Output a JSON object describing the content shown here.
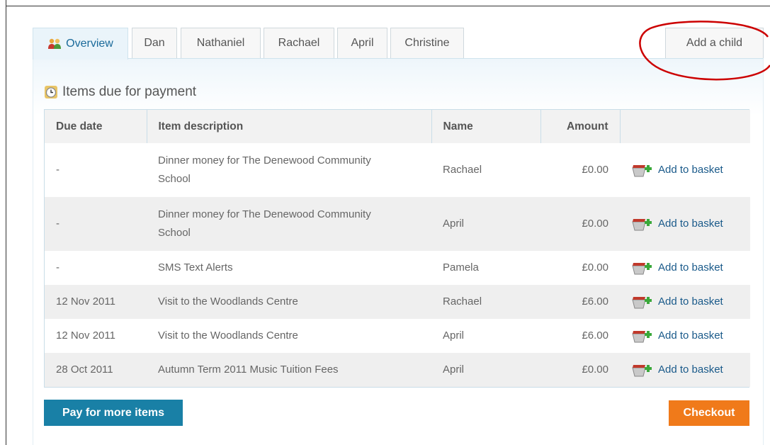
{
  "tabs": [
    {
      "label": "Overview",
      "active": true
    },
    {
      "label": "Dan"
    },
    {
      "label": "Nathaniel"
    },
    {
      "label": "Rachael"
    },
    {
      "label": "April"
    },
    {
      "label": "Christine"
    }
  ],
  "add_child_label": "Add a child",
  "section_title": "Items due for payment",
  "table": {
    "headers": {
      "due_date": "Due date",
      "description": "Item description",
      "name": "Name",
      "amount": "Amount"
    },
    "rows": [
      {
        "due": "-",
        "desc": "Dinner money for The Denewood Community School",
        "name": "Rachael",
        "amount": "£0.00",
        "action": "Add to basket"
      },
      {
        "due": "-",
        "desc": "Dinner money for The Denewood Community School",
        "name": "April",
        "amount": "£0.00",
        "action": "Add to basket"
      },
      {
        "due": "-",
        "desc": "SMS Text Alerts",
        "name": "Pamela",
        "amount": "£0.00",
        "action": "Add to basket"
      },
      {
        "due": "12 Nov 2011",
        "desc": "Visit to the Woodlands Centre",
        "name": "Rachael",
        "amount": "£6.00",
        "action": "Add to basket"
      },
      {
        "due": "12 Nov 2011",
        "desc": "Visit to the Woodlands Centre",
        "name": "April",
        "amount": "£6.00",
        "action": "Add to basket"
      },
      {
        "due": "28 Oct 2011",
        "desc": "Autumn Term 2011 Music Tuition Fees",
        "name": "April",
        "amount": "£0.00",
        "action": "Add to basket"
      }
    ]
  },
  "buttons": {
    "pay_more": "Pay for more items",
    "checkout": "Checkout"
  },
  "colors": {
    "accent_blue": "#1980a6",
    "checkout_orange": "#f07a1a",
    "annotation_red": "#cc0000"
  },
  "icons": [
    "people-icon",
    "clock-icon",
    "basket-icon"
  ]
}
